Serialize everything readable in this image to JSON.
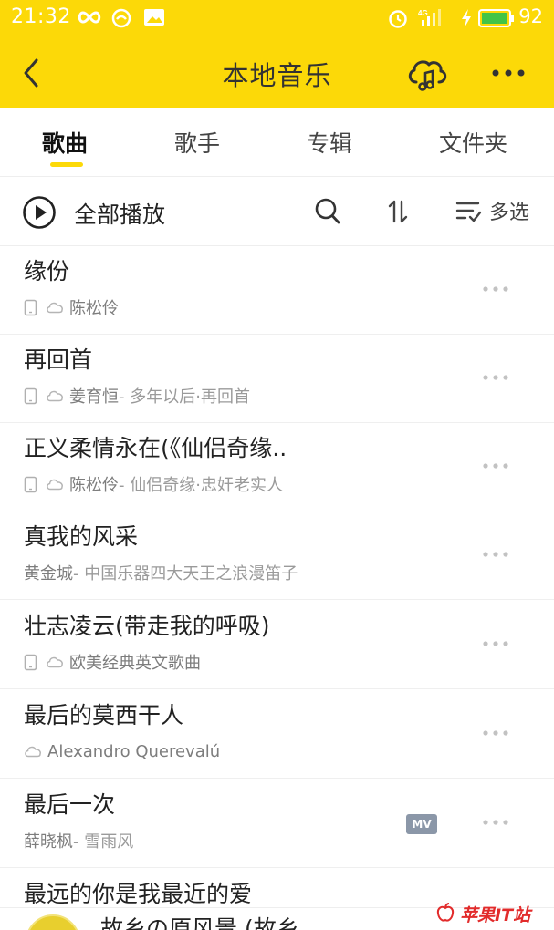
{
  "status_bar": {
    "time": "21:32",
    "battery": "92",
    "network": "4G",
    "icons": [
      "infinity-icon",
      "circle-app-icon",
      "image-icon",
      "alarm-icon",
      "signal-icon",
      "charging-icon",
      "battery-icon"
    ]
  },
  "header": {
    "title": "本地音乐",
    "back_icon": "chevron-left-icon",
    "cloud_icon": "cloud-music-icon",
    "more_icon": "more-dots-icon"
  },
  "tabs": [
    {
      "label": "歌曲",
      "active": true
    },
    {
      "label": "歌手",
      "active": false
    },
    {
      "label": "专辑",
      "active": false
    },
    {
      "label": "文件夹",
      "active": false
    }
  ],
  "actions": {
    "play_all_label": "全部播放",
    "multi_select_label": "多选"
  },
  "songs": [
    {
      "title": "缘份",
      "artist": "陈松伶",
      "album": "",
      "phone": true,
      "cloud": true,
      "mv": false
    },
    {
      "title": "再回首",
      "artist": "姜育恒",
      "album": " - 多年以后·再回首",
      "phone": true,
      "cloud": true,
      "mv": false
    },
    {
      "title": "正义柔情永在(《仙侣奇缘..",
      "artist": "陈松伶",
      "album": " - 仙侣奇缘·忠奸老实人",
      "phone": true,
      "cloud": true,
      "mv": false
    },
    {
      "title": "真我的风采",
      "artist": "黄金城",
      "album": " - 中国乐器四大天王之浪漫笛子",
      "phone": false,
      "cloud": false,
      "mv": false
    },
    {
      "title": "壮志凌云(带走我的呼吸)",
      "artist": "欧美经典英文歌曲",
      "album": "",
      "phone": true,
      "cloud": true,
      "mv": false
    },
    {
      "title": "最后的莫西干人",
      "artist": "Alexandro Querevalú",
      "album": "",
      "phone": false,
      "cloud": true,
      "mv": false
    },
    {
      "title": "最后一次",
      "artist": "薛晓枫",
      "album": " - 雪雨风",
      "phone": false,
      "cloud": false,
      "mv": true,
      "mv_label": "MV"
    },
    {
      "title": "最远的你是我最近的爱",
      "artist": "",
      "album": "",
      "phone": false,
      "cloud": false,
      "mv": false
    }
  ],
  "player": {
    "now_playing": "故乡の原风景 (故乡"
  },
  "watermark": {
    "text": "苹果IT站"
  },
  "colors": {
    "accent": "#fcd908",
    "text_primary": "#222222",
    "text_secondary": "#8a8a8a",
    "mv_badge": "#8b97a8"
  }
}
